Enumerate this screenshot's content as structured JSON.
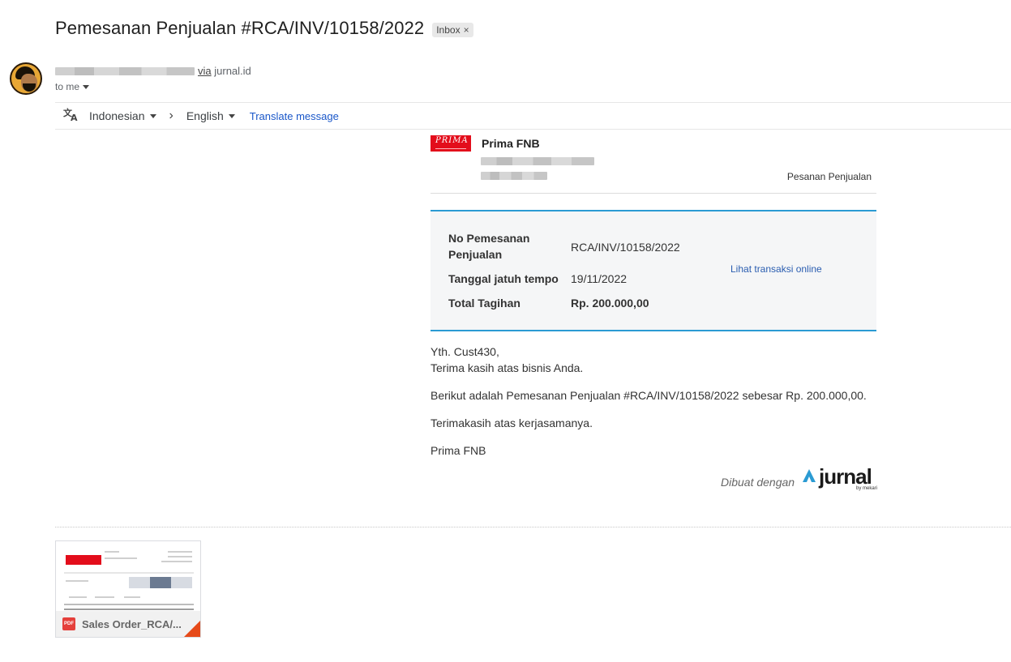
{
  "email": {
    "subject": "Pemesanan Penjualan #RCA/INV/10158/2022",
    "label": "Inbox",
    "label_close": "×",
    "via_word": "via",
    "via_domain": "jurnal.id",
    "to_me": "to me"
  },
  "translate": {
    "source_lang": "Indonesian",
    "target_lang": "English",
    "action": "Translate message"
  },
  "invoice": {
    "company": "Prima FNB",
    "document_type": "Pesanan Penjualan",
    "order_no_label": "No Pemesanan Penjualan",
    "order_no_value": "RCA/INV/10158/2022",
    "due_date_label": "Tanggal jatuh tempo",
    "due_date_value": "19/11/2022",
    "total_label": "Total Tagihan",
    "total_value": "Rp. 200.000,00",
    "online_link": "Lihat transaksi online"
  },
  "message": {
    "greeting": "Yth. Cust430,",
    "thanks": "Terima kasih atas bisnis Anda.",
    "line1": "Berikut adalah Pemesanan Penjualan #RCA/INV/10158/2022 sebesar Rp. 200.000,00.",
    "line2": "Terimakasih atas kerjasamanya.",
    "signature": "Prima FNB"
  },
  "footer": {
    "made_with": "Dibuat dengan",
    "brand": "jurnal",
    "brand_sub": "by mekari"
  },
  "attachment": {
    "name": "Sales Order_RCA/...",
    "type_label": "PDF"
  },
  "colors": {
    "accent_blue": "#2b9bd3",
    "link_blue": "#1a57c9",
    "logo_red": "#e30d1b",
    "pdf_red": "#e5403b"
  }
}
